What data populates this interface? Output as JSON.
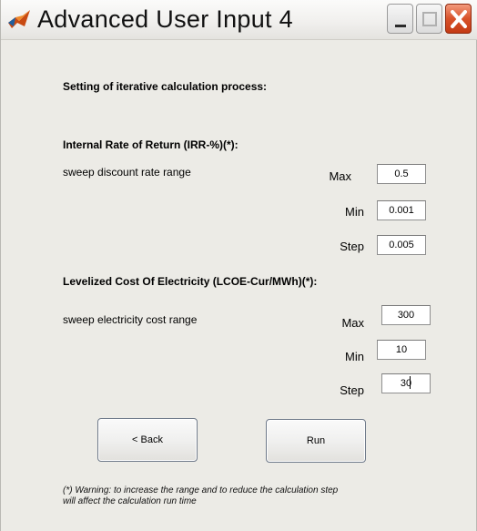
{
  "window": {
    "title": "Advanced User Input 4",
    "icons": {
      "app": "matlab-icon",
      "minimize": "minimize-icon",
      "maximize": "maximize-icon",
      "close": "close-icon"
    },
    "colors": {
      "close_button": "#d8522a",
      "body_bg": "#ecebe6"
    }
  },
  "header": {
    "heading": "Setting of iterative calculation process:"
  },
  "irr": {
    "heading": "Internal Rate of Return (IRR-%)(*):",
    "row_label": "sweep discount rate range",
    "max": {
      "label": "Max",
      "value": "0.5"
    },
    "min": {
      "label": "Min",
      "value": "0.001"
    },
    "step": {
      "label": "Step",
      "value": "0.005"
    }
  },
  "lcoe": {
    "heading": "Levelized Cost Of Electricity (LCOE-Cur/MWh)(*):",
    "row_label": "sweep electricity cost range",
    "max": {
      "label": "Max",
      "value": "300"
    },
    "min": {
      "label": "Min",
      "value": "10"
    },
    "step": {
      "label": "Step",
      "value": "30"
    }
  },
  "buttons": {
    "back": "< Back",
    "run": "Run"
  },
  "footer": {
    "note_line1": "(*) Warning: to increase the range and to reduce the calculation step",
    "note_line2": "will affect the calculation run time"
  }
}
